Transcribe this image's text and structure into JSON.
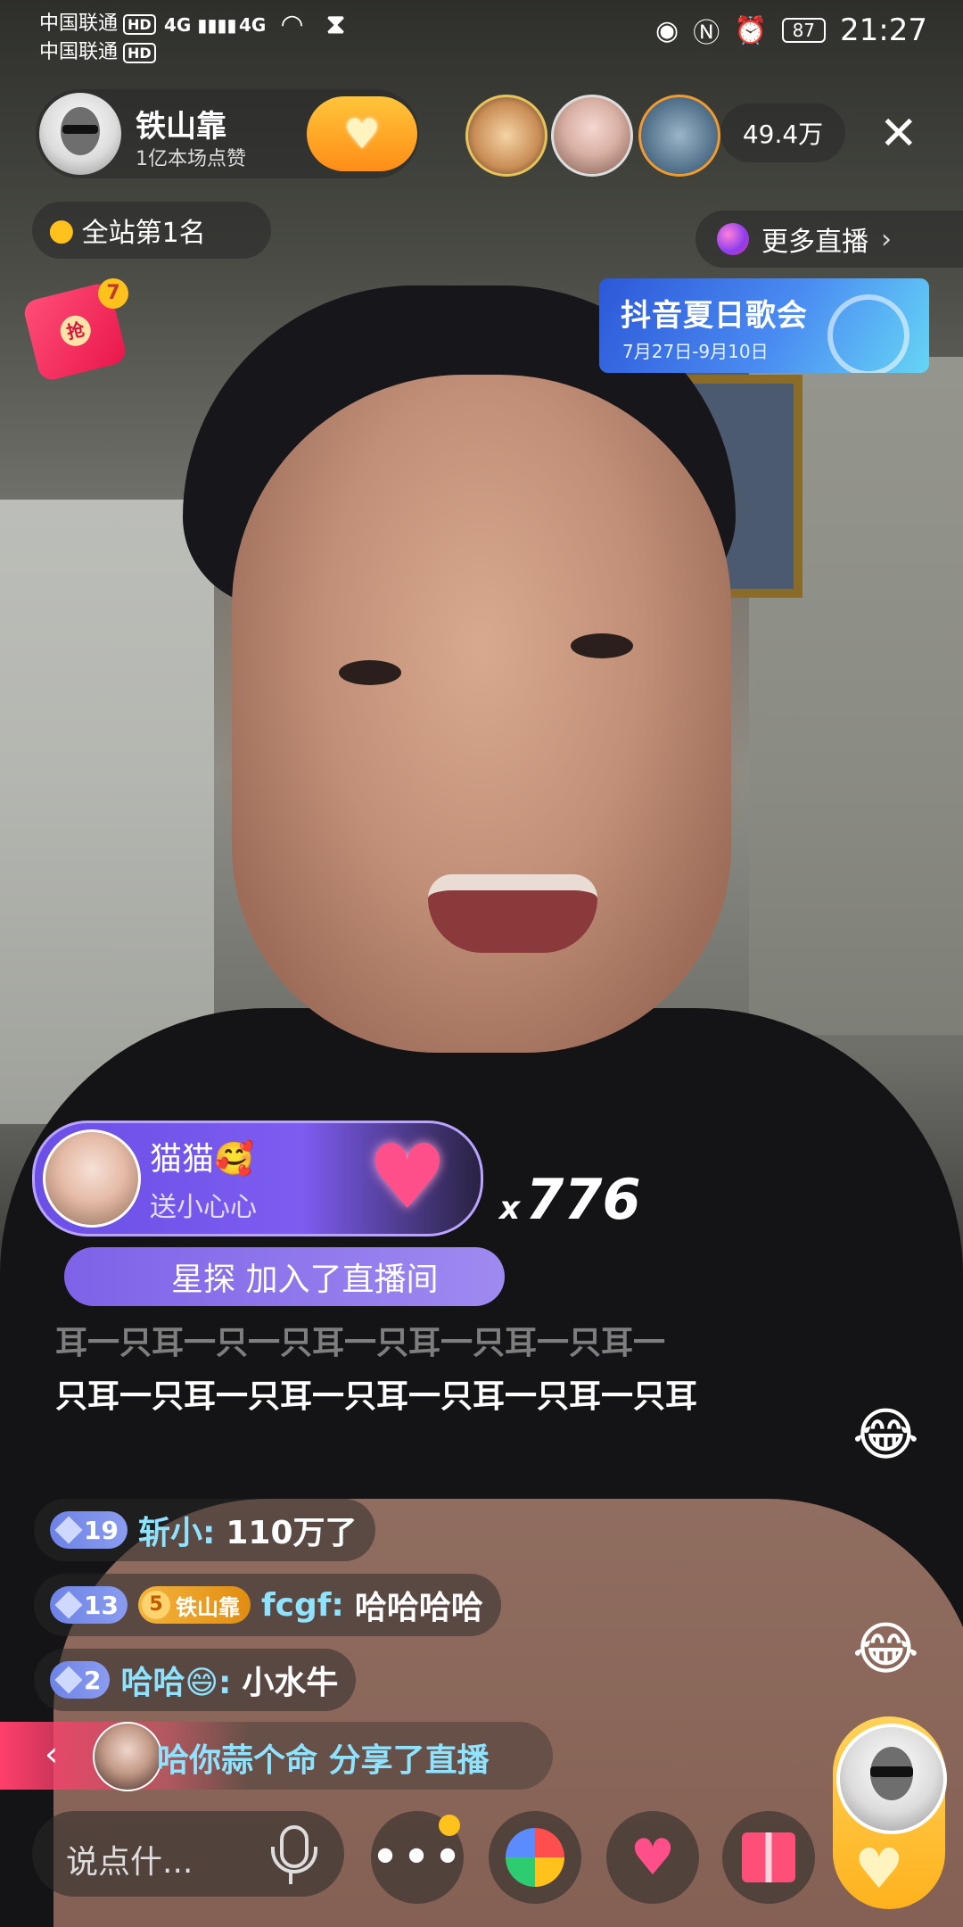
{
  "status_bar": {
    "carrier1": "中国联通",
    "carrier2": "中国联通",
    "hd": "HD",
    "net1": "4G",
    "net2": "4G",
    "battery": "87",
    "time": "21:27"
  },
  "host": {
    "name": "铁山靠",
    "likes": "1亿本场点赞"
  },
  "audience": {
    "viewer_count": "49.4万"
  },
  "rank": {
    "label": "全站第1名"
  },
  "more_live": {
    "label": "更多直播"
  },
  "red_packet": {
    "seal": "抢",
    "badge": "7"
  },
  "event_banner": {
    "title": "抖音夏日歌会",
    "date": "7月27日-9月10日"
  },
  "gift": {
    "user": "猫猫🥰",
    "action": "送小心心",
    "count_prefix": "x",
    "count": "776"
  },
  "join_notice": {
    "text": "星探 加入了直播间"
  },
  "chat": {
    "faded_line": "耳一只耳一只一只耳一只耳一只耳一只耳一",
    "main_text": "只耳一只耳一只耳一只耳一只耳一只耳一只耳",
    "messages": [
      {
        "level": "19",
        "user": "斩小:",
        "text": "110万了"
      },
      {
        "level": "13",
        "fan_level": "5",
        "fan_club": "铁山靠",
        "user": "fcgf:",
        "text": "哈哈哈哈"
      },
      {
        "level": "2",
        "user": "哈哈😄:",
        "text": "小水牛"
      }
    ],
    "share": "哈你蒜个命 分享了直播"
  },
  "bottom_bar": {
    "comment_placeholder": "说点什..."
  },
  "icons": {
    "close": "close-icon",
    "mic": "microphone-icon",
    "more": "more-icon",
    "pinwheel": "pinwheel-icon",
    "heart": "heart-icon",
    "gift": "gift-icon"
  },
  "colors": {
    "follow_button": "#ff9c1f",
    "gift_banner": "#7d5cf0",
    "username": "#8fe3ff",
    "accent_pink": "#ff3f6c"
  }
}
